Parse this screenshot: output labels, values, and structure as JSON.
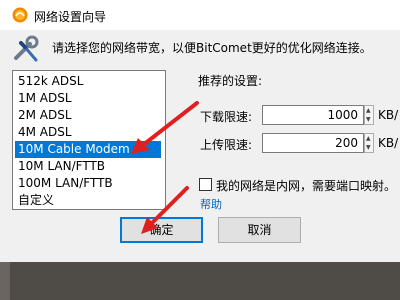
{
  "window": {
    "title": "网络设置向导",
    "prompt": "请选择您的网络带宽，以便BitComet更好的优化网络连接。"
  },
  "bandwidth_list": {
    "items": [
      "512k ADSL",
      "1M ADSL",
      "2M ADSL",
      "4M ADSL",
      "10M Cable Modem",
      "10M LAN/FTTB",
      "100M LAN/FTTB",
      "自定义"
    ],
    "selected_index": 4
  },
  "settings": {
    "recommended_label": "推荐的设置:",
    "download_label": "下载限速:",
    "download_value": "1000",
    "download_unit": "KB/",
    "upload_label": "上传限速:",
    "upload_value": "200",
    "upload_unit": "KB/"
  },
  "lan": {
    "checkbox_label": "我的网络是内网，需要端口映射。",
    "checked": false,
    "help_link": "帮助"
  },
  "buttons": {
    "ok": "确定",
    "cancel": "取消"
  },
  "colors": {
    "selection": "#0078d7",
    "annotation_arrow": "#e02020",
    "link": "#0066cc"
  }
}
